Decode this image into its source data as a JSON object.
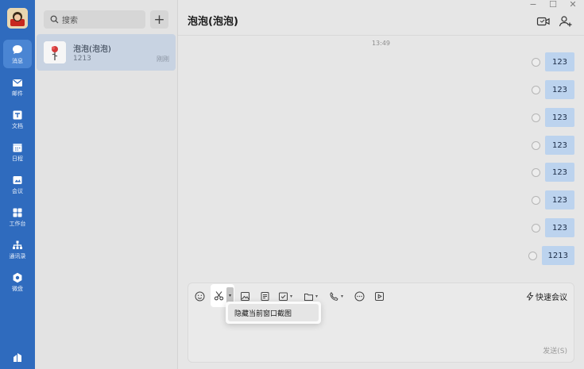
{
  "sidebar": {
    "items": [
      {
        "label": "消息",
        "icon": "chat-bubble-icon",
        "active": true
      },
      {
        "label": "邮件",
        "icon": "mail-icon"
      },
      {
        "label": "文档",
        "icon": "document-icon"
      },
      {
        "label": "日程",
        "icon": "calendar-icon"
      },
      {
        "label": "会议",
        "icon": "meeting-icon"
      },
      {
        "label": "工作台",
        "icon": "workbench-icon"
      },
      {
        "label": "通讯录",
        "icon": "contacts-icon"
      },
      {
        "label": "微盘",
        "icon": "drive-icon"
      }
    ],
    "bottom_icon": "more-apps-icon"
  },
  "conversation_list": {
    "search_placeholder": "搜索",
    "add_label": "+",
    "conversations": [
      {
        "name": "泡泡(泡泡)",
        "preview": "1213",
        "time": "刚刚"
      }
    ]
  },
  "chat": {
    "title": "泡泡(泡泡)",
    "timestamp": "13:49",
    "messages": [
      "123",
      "123",
      "123",
      "123",
      "123",
      "123",
      "123",
      "1213"
    ]
  },
  "window_controls": {
    "minimize": "−",
    "maximize": "☐",
    "close": "✕"
  },
  "input": {
    "quick_meeting_label": "快速会议",
    "send_label": "发送(S)",
    "screenshot_menu_item": "隐藏当前窗口截图"
  },
  "colors": {
    "rail": "#2f6bbe",
    "bubble": "#bcd3ee",
    "selected_conversation": "#c8d3e2"
  }
}
